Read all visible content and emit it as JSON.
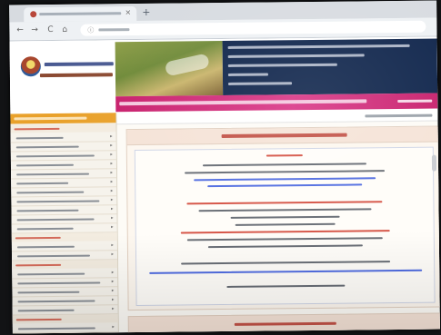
{
  "browser": {
    "tab": {
      "title": "",
      "favicon": "site-favicon-icon"
    },
    "new_tab_symbol": "+",
    "close_symbol": "×",
    "nav": {
      "back": "←",
      "forward": "→",
      "reload": "C",
      "home": "⌂"
    },
    "address_bar": {
      "url": "",
      "icon": "page-info-icon"
    }
  },
  "header": {
    "logo": "organization-emblem-icon",
    "site_name": "",
    "site_subtitle": "",
    "info_lines": [
      "",
      "",
      "",
      "",
      ""
    ]
  },
  "ticker": {
    "text": "",
    "side_text": "",
    "color": "#c71e6b"
  },
  "sidebar": {
    "title": "",
    "groups": [
      {
        "heading": "",
        "items": [
          "",
          "",
          "",
          "",
          "",
          "",
          "",
          "",
          "",
          "",
          ""
        ]
      },
      {
        "heading": "",
        "items": [
          "",
          ""
        ]
      },
      {
        "heading": "",
        "items": [
          "",
          "",
          "",
          "",
          ""
        ]
      },
      {
        "heading": "",
        "items": [
          "",
          ""
        ]
      }
    ]
  },
  "content": {
    "date": "",
    "panel_title": "",
    "notice": {
      "lines": [
        {
          "text": "",
          "color": "red"
        },
        {
          "text": "",
          "color": "black"
        },
        {
          "text": "",
          "color": "black"
        },
        {
          "text": "",
          "color": "blue"
        },
        {
          "text": "",
          "color": "blue"
        },
        {
          "text": "",
          "color": "red"
        },
        {
          "text": "",
          "color": "black"
        },
        {
          "text": "",
          "color": "black"
        },
        {
          "text": "",
          "color": "black"
        },
        {
          "text": "",
          "color": "red"
        },
        {
          "text": "",
          "color": "black"
        },
        {
          "text": "",
          "color": "black"
        },
        {
          "text": "",
          "color": "black"
        },
        {
          "text": "",
          "color": "blue"
        },
        {
          "text": "",
          "color": "black"
        }
      ]
    },
    "section2_title": ""
  },
  "colors": {
    "sidebar_title_bg": "#e9a12b",
    "banner_bg": "#0d234a",
    "panel_header_bg": "#f5e3d7",
    "link_blue": "#2c4ecb",
    "alert_red": "#c0392b"
  }
}
